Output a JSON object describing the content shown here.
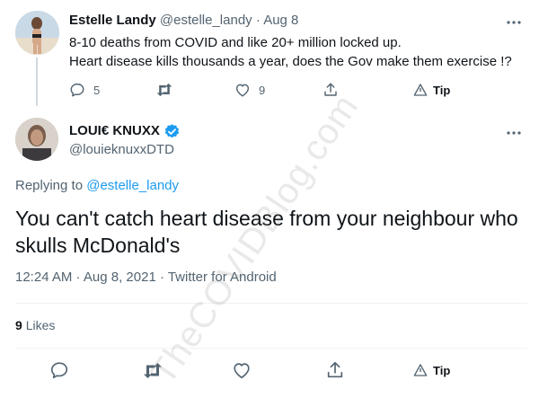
{
  "parent_tweet": {
    "display_name": "Estelle Landy",
    "handle": "@estelle_landy",
    "separator": "·",
    "date": "Aug 8",
    "text_line1": "8-10 deaths from COVID and like 20+ million locked up.",
    "text_line2": "Heart disease kills thousands a year, does the Gov make them exercise !?",
    "reply_count": "5",
    "like_count": "9",
    "tip_label": "Tip"
  },
  "main_tweet": {
    "display_name": "LOUI€ KNUXX",
    "handle": "@louieknuxxDTD",
    "replying_prefix": "Replying to",
    "replying_mention": "@estelle_landy",
    "text": "You can't catch heart disease from your neighbour who skulls McDonald's",
    "timestamp": "12:24 AM · Aug 8, 2021 · Twitter for Android",
    "likes_count": "9",
    "likes_label": "Likes",
    "tip_label": "Tip"
  },
  "watermark": "TheCOVIDBlog.com",
  "colors": {
    "accent": "#1d9bf0",
    "muted": "#536471",
    "text": "#0f1419",
    "divider": "#eff3f4"
  },
  "icons": [
    "more-icon",
    "reply-icon",
    "retweet-icon",
    "like-icon",
    "share-icon",
    "tip-icon",
    "verified-icon"
  ]
}
